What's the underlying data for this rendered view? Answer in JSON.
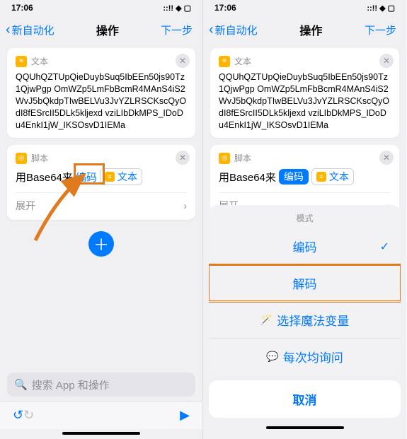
{
  "status": {
    "time": "17:06",
    "indicators": "::!! ◆ ▢"
  },
  "nav": {
    "back": "新自动化",
    "title": "操作",
    "next": "下一步"
  },
  "textCard": {
    "label": "文本",
    "body": "QQUhQZTUpQieDuybSuq5IbEEn50js90Tz1QjwPgp\nOmWZp5LmFbBcmR4MAnS4iS2WvJ5bQkdpTIwBELVu3JvYZLRSCKscQyOdI8fESrcII5DLk5kljexd\nvziLIbDkMPS_IDoDu4EnkI1jW_IKSOsvD1IEMa"
  },
  "scriptCard": {
    "label": "脚本",
    "prefix": "用Base64来",
    "mode": "编码",
    "varLabel": "文本",
    "expand": "展开"
  },
  "search": {
    "placeholder": "搜索 App 和操作"
  },
  "sheet": {
    "title": "模式",
    "opt1": "编码",
    "opt2": "解码",
    "magic": "选择魔法变量",
    "ask": "每次均询问",
    "cancel": "取消"
  }
}
